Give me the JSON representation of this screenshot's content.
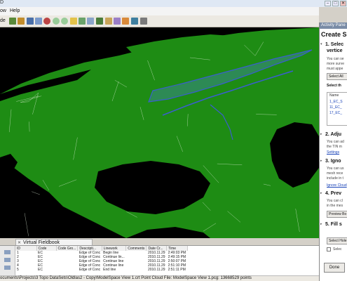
{
  "window": {
    "title_fragment": "D",
    "controls": [
      "–",
      "□",
      "✕"
    ]
  },
  "menu": {
    "items": [
      "ow",
      "Help"
    ]
  },
  "toolbar": {
    "partial_label": "de"
  },
  "viewport": {
    "background": "#000000",
    "mesh_color": "#1e8c14"
  },
  "fieldbook": {
    "tab_label": "Virtual Fieldbook",
    "close_glyph": "✕",
    "columns": [
      "ID",
      "Code",
      "Code Gro...",
      "Descripti...",
      "Linework",
      "Comments",
      "Date Cr...",
      "Time"
    ],
    "rows": [
      [
        "1",
        "EC",
        "",
        "Edge of Conc",
        "Begin line",
        "",
        "2010.11.29",
        "2:49:03 PM"
      ],
      [
        "2",
        "EC",
        "",
        "Edge of Conc",
        "Continue lin...",
        "",
        "2010.11.29",
        "2:49:15 PM"
      ],
      [
        "3",
        "EC",
        "",
        "Edge of Conc",
        "Continue line",
        "",
        "2010.11.29",
        "2:50:07 PM"
      ],
      [
        "4",
        "EC",
        "",
        "Edge of Conc",
        "Continue line",
        "",
        "2010.11.29",
        "2:51:10 PM"
      ],
      [
        "5",
        "EC",
        "",
        "Edge of Conc",
        "End line",
        "",
        "2010.11.29",
        "2:51:11 PM"
      ]
    ]
  },
  "status": {
    "text": "ocuments\\Projects\\3 Topo DataSets\\Oldlas2 - Copy\\ModelSpace  View 1.crt  Point Cloud File: ModelSpace  View 1.pcg: 13668529 points"
  },
  "activity_pane": {
    "header": "Activity Pane",
    "title": "Create Si",
    "steps": [
      {
        "number": "1.",
        "title": "Selec",
        "subtitle": "vertice",
        "text": [
          "You can se",
          "more surve",
          "must appe"
        ]
      },
      {
        "number": "2.",
        "title": "Adju",
        "text": [
          "You can ad",
          "the TIN m"
        ]
      },
      {
        "number": "3.",
        "title": "Igno",
        "text": [
          "You can us",
          "mesh rece",
          "include in t"
        ]
      },
      {
        "number": "4.",
        "title": "Prev",
        "text": [
          "You can cl",
          "in the mes"
        ]
      },
      {
        "number": "5.",
        "title": "Fill s",
        "text": []
      }
    ],
    "select_all_button": "Select All",
    "select_label": "Select th",
    "list_header": "Name",
    "list_items": [
      "1_EC_S",
      "11_EC_",
      "17_EC_"
    ],
    "settings_link": "Settings",
    "ignore_link": "Ignore Cloud",
    "preview_button": "Preview Bo",
    "select_holes_button": "Select Hole",
    "select_checkbox_label": "Selec",
    "done_button": "Done"
  }
}
